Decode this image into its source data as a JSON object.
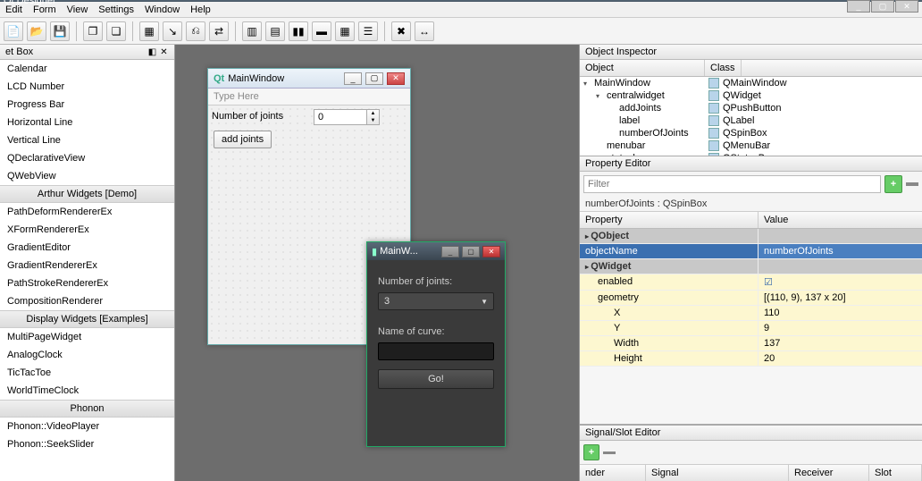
{
  "app": {
    "title": "Qt Designer"
  },
  "menu": [
    "Edit",
    "Form",
    "View",
    "Settings",
    "Window",
    "Help"
  ],
  "widgetbox": {
    "title": "et Box",
    "items": [
      {
        "t": "item",
        "label": "Calendar"
      },
      {
        "t": "item",
        "label": "LCD Number"
      },
      {
        "t": "item",
        "label": "Progress Bar"
      },
      {
        "t": "item",
        "label": "Horizontal Line"
      },
      {
        "t": "item",
        "label": "Vertical Line"
      },
      {
        "t": "item",
        "label": "QDeclarativeView"
      },
      {
        "t": "item",
        "label": "QWebView"
      },
      {
        "t": "cat",
        "label": "Arthur Widgets [Demo]"
      },
      {
        "t": "item",
        "label": "PathDeformRendererEx"
      },
      {
        "t": "item",
        "label": "XFormRendererEx"
      },
      {
        "t": "item",
        "label": "GradientEditor"
      },
      {
        "t": "item",
        "label": "GradientRendererEx"
      },
      {
        "t": "item",
        "label": "PathStrokeRendererEx"
      },
      {
        "t": "item",
        "label": "CompositionRenderer"
      },
      {
        "t": "cat",
        "label": "Display Widgets [Examples]"
      },
      {
        "t": "item",
        "label": "MultiPageWidget"
      },
      {
        "t": "item",
        "label": "AnalogClock"
      },
      {
        "t": "item",
        "label": "TicTacToe"
      },
      {
        "t": "item",
        "label": "WorldTimeClock"
      },
      {
        "t": "cat",
        "label": "Phonon"
      },
      {
        "t": "item",
        "label": "Phonon::VideoPlayer"
      },
      {
        "t": "item",
        "label": "Phonon::SeekSlider"
      }
    ]
  },
  "design_window": {
    "title": "MainWindow",
    "menu": "Type Here",
    "label": "Number of joints",
    "spin_value": "0",
    "button": "add joints"
  },
  "preview_window": {
    "title": "MainW...",
    "label1": "Number of joints:",
    "combo_value": "3",
    "label2": "Name of curve:",
    "button": "Go!"
  },
  "inspector": {
    "title": "Object Inspector",
    "cols": [
      "Object",
      "Class"
    ],
    "rows": [
      {
        "ind": 0,
        "obj": "MainWindow",
        "cls": "QMainWindow",
        "twisty": "▾"
      },
      {
        "ind": 1,
        "obj": "centralwidget",
        "cls": "QWidget",
        "twisty": "▾"
      },
      {
        "ind": 2,
        "obj": "addJoints",
        "cls": "QPushButton"
      },
      {
        "ind": 2,
        "obj": "label",
        "cls": "QLabel"
      },
      {
        "ind": 2,
        "obj": "numberOfJoints",
        "cls": "QSpinBox"
      },
      {
        "ind": 1,
        "obj": "menubar",
        "cls": "QMenuBar"
      },
      {
        "ind": 1,
        "obj": "statusbar",
        "cls": "QStatusBar"
      }
    ]
  },
  "prop": {
    "title": "Property Editor",
    "filter_ph": "Filter",
    "selected": "numberOfJoints : QSpinBox",
    "cols": [
      "Property",
      "Value"
    ],
    "rows": [
      {
        "kind": "cat",
        "k": "QObject"
      },
      {
        "kind": "sel",
        "k": "objectName",
        "v": "numberOfJoints"
      },
      {
        "kind": "cat",
        "k": "QWidget"
      },
      {
        "kind": "chk",
        "k": "enabled",
        "v": "",
        "cls": "prop-yellow ind1"
      },
      {
        "kind": "plain",
        "k": "geometry",
        "v": "[(110, 9), 137 x 20]",
        "cls": "prop-yellow ind1"
      },
      {
        "kind": "plain",
        "k": "X",
        "v": "110",
        "cls": "prop-yellow ind2"
      },
      {
        "kind": "plain",
        "k": "Y",
        "v": "9",
        "cls": "prop-yellow ind2"
      },
      {
        "kind": "plain",
        "k": "Width",
        "v": "137",
        "cls": "prop-yellow ind2"
      },
      {
        "kind": "plain",
        "k": "Height",
        "v": "20",
        "cls": "prop-yellow ind2"
      }
    ]
  },
  "sigslot": {
    "title": "Signal/Slot Editor",
    "cols": [
      "nder",
      "Signal",
      "Receiver",
      "Slot"
    ]
  }
}
